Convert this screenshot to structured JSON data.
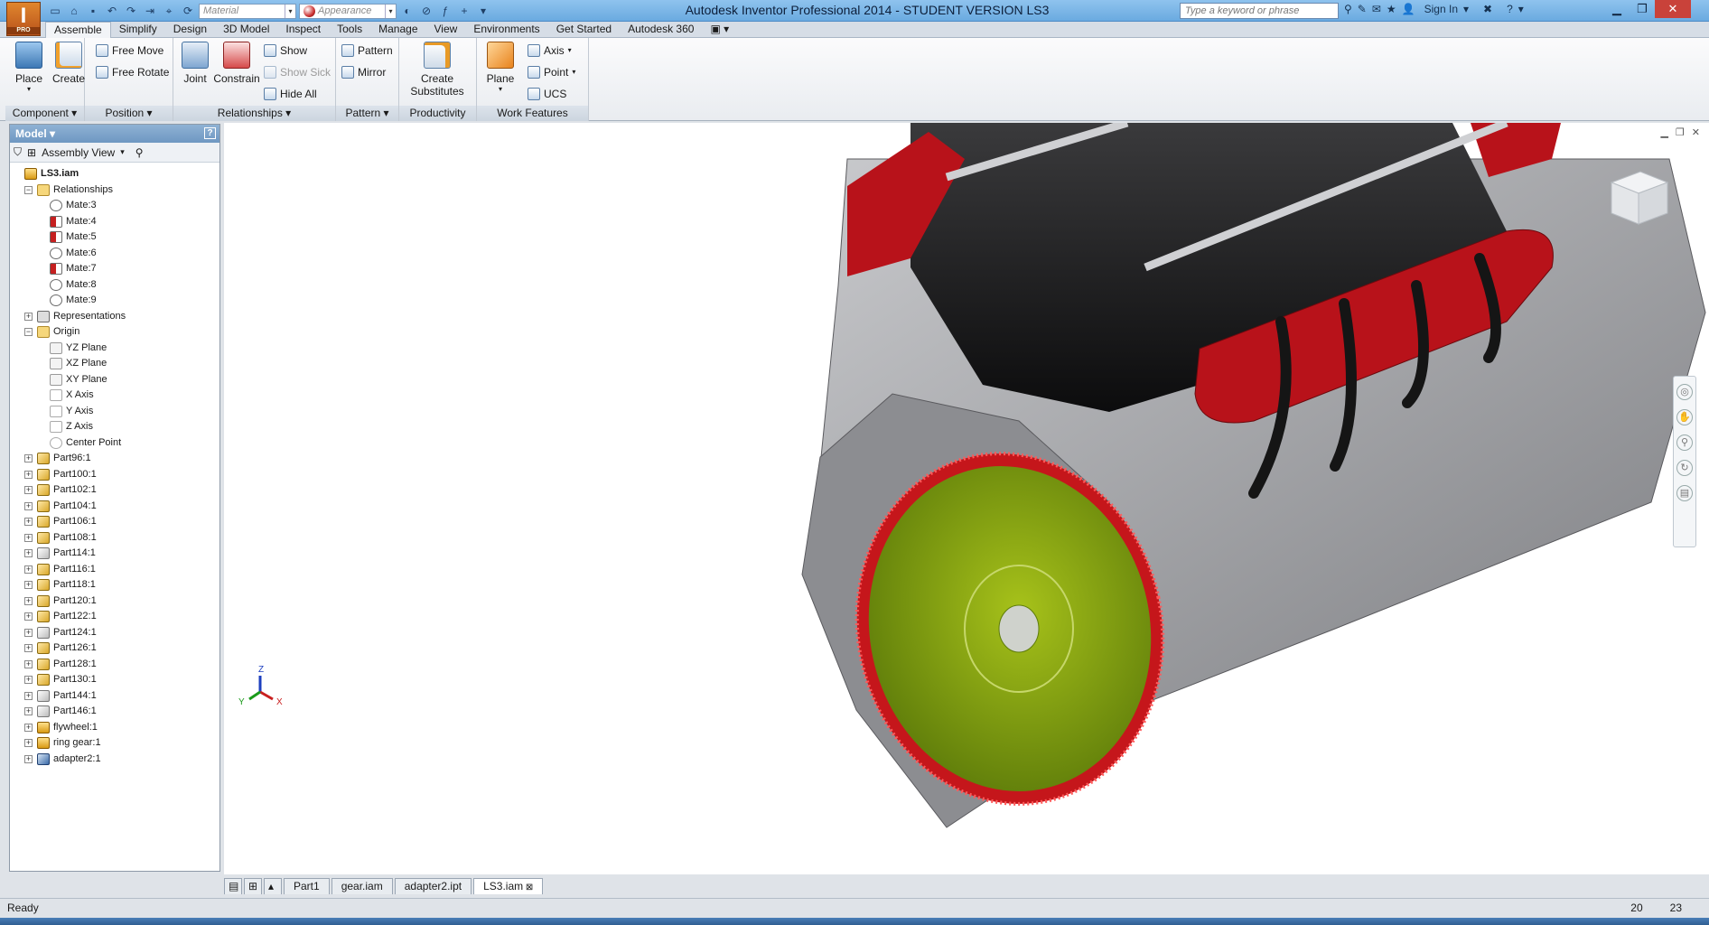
{
  "app": {
    "logo": "I",
    "logo_sub": "PRO",
    "title": "Autodesk Inventor Professional 2014 - STUDENT VERSION    LS3"
  },
  "qat": {
    "material": "Material",
    "appearance": "Appearance"
  },
  "search": {
    "placeholder": "Type a keyword or phrase"
  },
  "signin": "Sign In",
  "tabs": [
    "Assemble",
    "Simplify",
    "Design",
    "3D Model",
    "Inspect",
    "Tools",
    "Manage",
    "View",
    "Environments",
    "Get Started",
    "Autodesk 360"
  ],
  "ribbon": {
    "component": {
      "place": "Place",
      "create": "Create",
      "footer": "Component ▾"
    },
    "position": {
      "free_move": "Free Move",
      "free_rotate": "Free Rotate",
      "footer": "Position ▾"
    },
    "relationships": {
      "joint": "Joint",
      "constrain": "Constrain",
      "show": "Show",
      "show_sick": "Show Sick",
      "hide_all": "Hide All",
      "footer": "Relationships ▾"
    },
    "pattern": {
      "pattern": "Pattern",
      "mirror": "Mirror",
      "footer": "Pattern ▾"
    },
    "productivity": {
      "create_substitutes_1": "Create",
      "create_substitutes_2": "Substitutes",
      "footer": "Productivity"
    },
    "work_features": {
      "plane": "Plane",
      "axis": "Axis",
      "point": "Point",
      "ucs": "UCS",
      "footer": "Work Features"
    }
  },
  "browser": {
    "title": "Model ▾",
    "help": "?",
    "view": "Assembly View"
  },
  "tree": [
    {
      "label": "LS3.iam",
      "level": 0,
      "exp": "",
      "bold": true,
      "icon": "assembly"
    },
    {
      "label": "Relationships",
      "level": 1,
      "exp": "−",
      "icon": "folder"
    },
    {
      "label": "Mate:3",
      "level": 2,
      "exp": "",
      "icon": "mate"
    },
    {
      "label": "Mate:4",
      "level": 2,
      "exp": "",
      "icon": "mate-flush"
    },
    {
      "label": "Mate:5",
      "level": 2,
      "exp": "",
      "icon": "mate-flush"
    },
    {
      "label": "Mate:6",
      "level": 2,
      "exp": "",
      "icon": "mate"
    },
    {
      "label": "Mate:7",
      "level": 2,
      "exp": "",
      "icon": "mate-flush"
    },
    {
      "label": "Mate:8",
      "level": 2,
      "exp": "",
      "icon": "mate"
    },
    {
      "label": "Mate:9",
      "level": 2,
      "exp": "",
      "icon": "mate"
    },
    {
      "label": "Representations",
      "level": 1,
      "exp": "+",
      "icon": "rep"
    },
    {
      "label": "Origin",
      "level": 1,
      "exp": "−",
      "icon": "folder"
    },
    {
      "label": "YZ Plane",
      "level": 2,
      "exp": "",
      "icon": "plane"
    },
    {
      "label": "XZ Plane",
      "level": 2,
      "exp": "",
      "icon": "plane"
    },
    {
      "label": "XY Plane",
      "level": 2,
      "exp": "",
      "icon": "plane"
    },
    {
      "label": "X Axis",
      "level": 2,
      "exp": "",
      "icon": "axis"
    },
    {
      "label": "Y Axis",
      "level": 2,
      "exp": "",
      "icon": "axis"
    },
    {
      "label": "Z Axis",
      "level": 2,
      "exp": "",
      "icon": "axis"
    },
    {
      "label": "Center Point",
      "level": 2,
      "exp": "",
      "icon": "point"
    },
    {
      "label": "Part96:1",
      "level": 1,
      "exp": "+",
      "icon": "part"
    },
    {
      "label": "Part100:1",
      "level": 1,
      "exp": "+",
      "icon": "part"
    },
    {
      "label": "Part102:1",
      "level": 1,
      "exp": "+",
      "icon": "part"
    },
    {
      "label": "Part104:1",
      "level": 1,
      "exp": "+",
      "icon": "part"
    },
    {
      "label": "Part106:1",
      "level": 1,
      "exp": "+",
      "icon": "part"
    },
    {
      "label": "Part108:1",
      "level": 1,
      "exp": "+",
      "icon": "part"
    },
    {
      "label": "Part114:1",
      "level": 1,
      "exp": "+",
      "icon": "part-gray"
    },
    {
      "label": "Part116:1",
      "level": 1,
      "exp": "+",
      "icon": "part"
    },
    {
      "label": "Part118:1",
      "level": 1,
      "exp": "+",
      "icon": "part"
    },
    {
      "label": "Part120:1",
      "level": 1,
      "exp": "+",
      "icon": "part"
    },
    {
      "label": "Part122:1",
      "level": 1,
      "exp": "+",
      "icon": "part"
    },
    {
      "label": "Part124:1",
      "level": 1,
      "exp": "+",
      "icon": "part-gray"
    },
    {
      "label": "Part126:1",
      "level": 1,
      "exp": "+",
      "icon": "part"
    },
    {
      "label": "Part128:1",
      "level": 1,
      "exp": "+",
      "icon": "part"
    },
    {
      "label": "Part130:1",
      "level": 1,
      "exp": "+",
      "icon": "part"
    },
    {
      "label": "Part144:1",
      "level": 1,
      "exp": "+",
      "icon": "part-gray"
    },
    {
      "label": "Part146:1",
      "level": 1,
      "exp": "+",
      "icon": "part-gray"
    },
    {
      "label": "flywheel:1",
      "level": 1,
      "exp": "+",
      "icon": "assembly"
    },
    {
      "label": "ring gear:1",
      "level": 1,
      "exp": "+",
      "icon": "assembly"
    },
    {
      "label": "adapter2:1",
      "level": 1,
      "exp": "+",
      "icon": "part-blue"
    }
  ],
  "doc_tabs": [
    "Part1",
    "gear.iam",
    "adapter2.ipt",
    "LS3.iam"
  ],
  "active_doc": "LS3.iam",
  "status": {
    "text": "Ready",
    "n1": "20",
    "n2": "23"
  },
  "colors": {
    "accent": "#6aaae0",
    "engine_red": "#c5161b",
    "flywheel": "#7a9a10",
    "block": "#a6a7aa"
  }
}
